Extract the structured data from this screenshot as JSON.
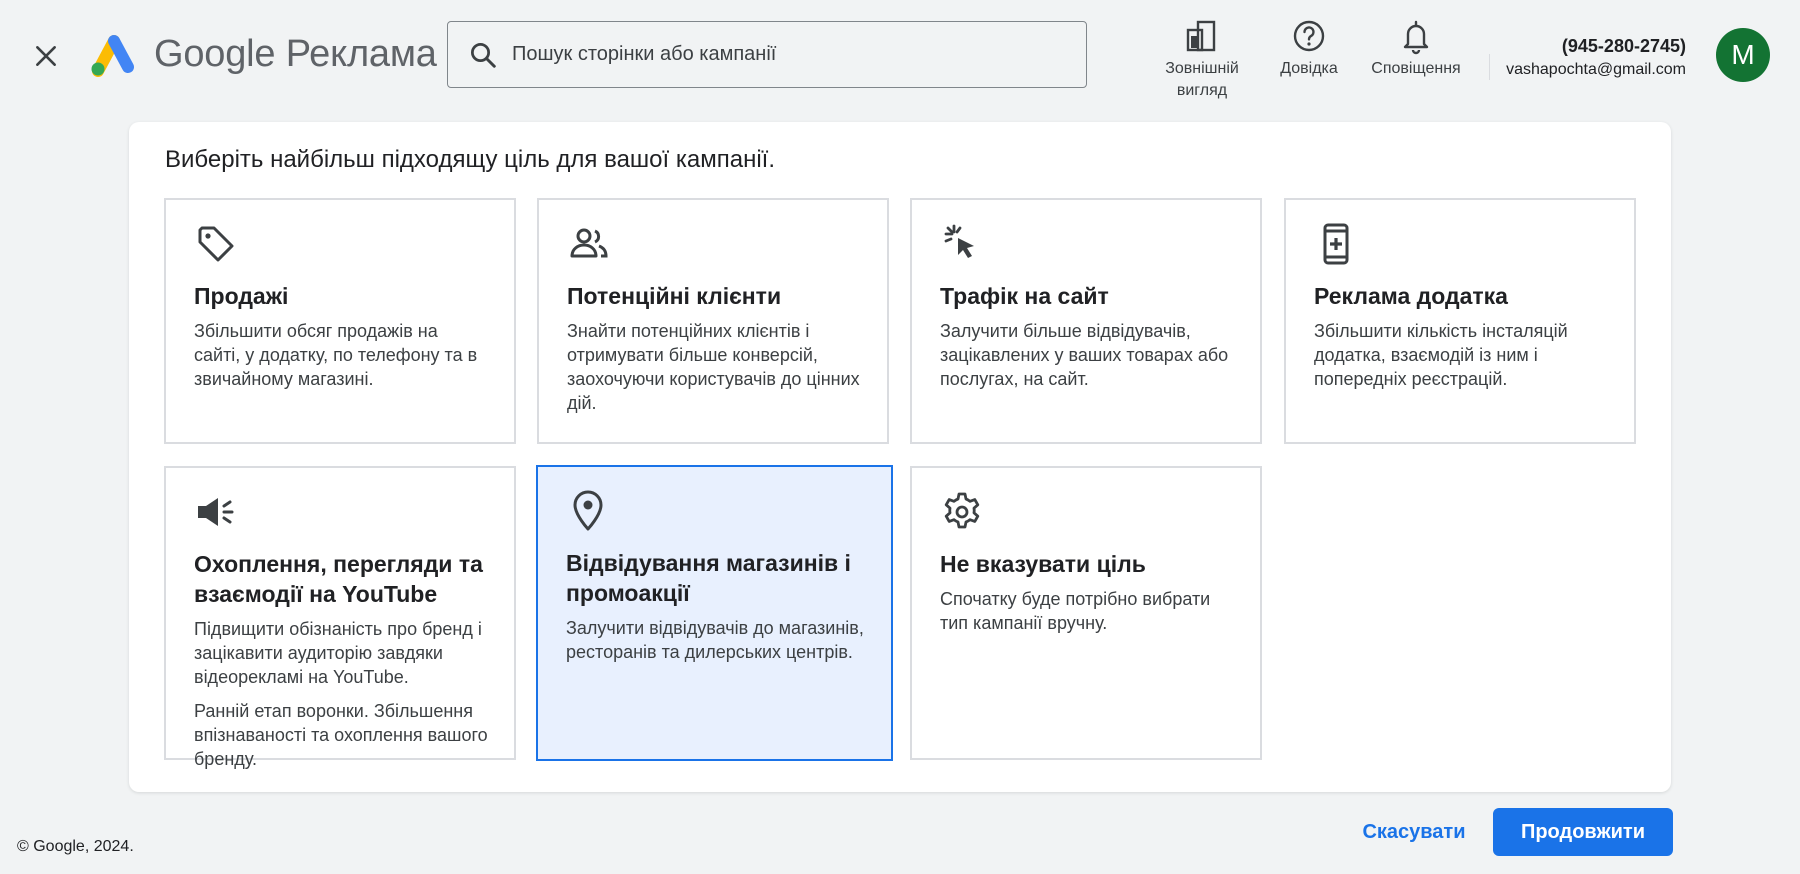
{
  "header": {
    "close_icon": "close-icon",
    "logo_brand": "Google",
    "logo_product": "Реклама",
    "search_placeholder": "Пошук сторінки або кампанії",
    "actions": [
      {
        "icon": "appearance-icon",
        "label": "Зовнішній вигляд"
      },
      {
        "icon": "help-icon",
        "label": "Довідка"
      },
      {
        "icon": "bell-icon",
        "label": "Сповіщення"
      }
    ],
    "account_phone": "(945-280-2745)",
    "account_email": "vashapochta@gmail.com",
    "avatar_letter": "M",
    "avatar_color": "#137333"
  },
  "main": {
    "title": "Виберіть найбільш підходящу ціль для вашої кампанії.",
    "goals": [
      {
        "icon": "tag-icon",
        "title": "Продажі",
        "desc": "Збільшити обсяг продажів на сайті, у додатку, по телефону та в звичайному магазині.",
        "selected": false
      },
      {
        "icon": "people-icon",
        "title": "Потенційні клієнти",
        "desc": "Знайти потенційних клієнтів і отримувати більше конверсій, заохочуючи користувачів до цінних дій.",
        "selected": false
      },
      {
        "icon": "cursor-click-icon",
        "title": "Трафік на сайт",
        "desc": "Залучити більше відвідувачів, зацікавлених у ваших товарах або послугах, на сайт.",
        "selected": false
      },
      {
        "icon": "phone-app-icon",
        "title": "Реклама додатка",
        "desc": "Збільшити кількість інсталяцій додатка, взаємодій із ним і попередніх реєстрацій.",
        "selected": false
      },
      {
        "icon": "megaphone-icon",
        "title": "Охоплення, перегляди та взаємодії на YouTube",
        "desc": "Підвищити обізнаність про бренд і зацікавити аудиторію завдяки відеорекламі на YouTube.",
        "desc2": "Ранній етап воронки. Збільшення впізнаваності та охоплення вашого бренду.",
        "selected": false
      },
      {
        "icon": "location-pin-icon",
        "title": "Відвідування магазинів і промоакції",
        "desc": "Залучити відвідувачів до магазинів, ресторанів та дилерських центрів.",
        "selected": true
      },
      {
        "icon": "gear-icon",
        "title": "Не вказувати ціль",
        "desc": "Спочатку буде потрібно вибрати тип кампанії вручну.",
        "selected": false
      }
    ]
  },
  "footer": {
    "copyright": "© Google, 2024.",
    "cancel_label": "Скасувати",
    "continue_label": "Продовжити",
    "accent_color": "#1a73e8"
  }
}
